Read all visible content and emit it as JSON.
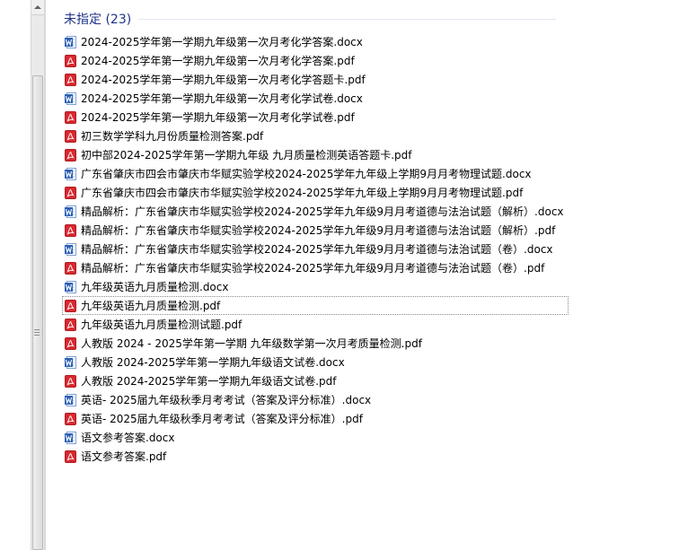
{
  "group": {
    "title": "未指定 (23)"
  },
  "files": [
    {
      "name": "2024-2025学年第一学期九年级第一次月考化学答案.docx",
      "type": "word-icon"
    },
    {
      "name": "2024-2025学年第一学期九年级第一次月考化学答案.pdf",
      "type": "pdf-icon"
    },
    {
      "name": "2024-2025学年第一学期九年级第一次月考化学答题卡.pdf",
      "type": "pdf-icon"
    },
    {
      "name": "2024-2025学年第一学期九年级第一次月考化学试卷.docx",
      "type": "word-icon"
    },
    {
      "name": "2024-2025学年第一学期九年级第一次月考化学试卷.pdf",
      "type": "pdf-icon"
    },
    {
      "name": "初三数学学科九月份质量检测答案.pdf",
      "type": "pdf-icon"
    },
    {
      "name": "初中部2024-2025学年第一学期九年级 九月质量检测英语答题卡.pdf",
      "type": "pdf-icon"
    },
    {
      "name": "广东省肇庆市四会市肇庆市华赋实验学校2024-2025学年九年级上学期9月月考物理试题.docx",
      "type": "word-icon"
    },
    {
      "name": "广东省肇庆市四会市肇庆市华赋实验学校2024-2025学年九年级上学期9月月考物理试题.pdf",
      "type": "pdf-icon"
    },
    {
      "name": "精品解析：广东省肇庆市华赋实验学校2024-2025学年九年级9月月考道德与法治试题（解析）.docx",
      "type": "word-icon"
    },
    {
      "name": "精品解析：广东省肇庆市华赋实验学校2024-2025学年九年级9月月考道德与法治试题（解析）.pdf",
      "type": "pdf-icon"
    },
    {
      "name": "精品解析：广东省肇庆市华赋实验学校2024-2025学年九年级9月月考道德与法治试题（卷）.docx",
      "type": "word-icon"
    },
    {
      "name": "精品解析：广东省肇庆市华赋实验学校2024-2025学年九年级9月月考道德与法治试题（卷）.pdf",
      "type": "pdf-icon"
    },
    {
      "name": "九年级英语九月质量检测.docx",
      "type": "word-icon"
    },
    {
      "name": "九年级英语九月质量检测.pdf",
      "type": "pdf-icon",
      "focused": true
    },
    {
      "name": "九年级英语九月质量检测试题.pdf",
      "type": "pdf-icon"
    },
    {
      "name": "人教版 2024 - 2025学年第一学期 九年级数学第一次月考质量检测.pdf",
      "type": "pdf-icon"
    },
    {
      "name": "人教版 2024-2025学年第一学期九年级语文试卷.docx",
      "type": "word-icon"
    },
    {
      "name": "人教版 2024-2025学年第一学期九年级语文试卷.pdf",
      "type": "pdf-icon"
    },
    {
      "name": "英语- 2025届九年级秋季月考考试（答案及评分标准）.docx",
      "type": "word-icon"
    },
    {
      "name": "英语- 2025届九年级秋季月考考试（答案及评分标准）.pdf",
      "type": "pdf-icon"
    },
    {
      "name": "语文参考答案.docx",
      "type": "word-icon"
    },
    {
      "name": "语文参考答案.pdf",
      "type": "pdf-icon"
    }
  ],
  "colors": {
    "header_text": "#1e3287",
    "word_icon": "#2b5fb4",
    "pdf_icon": "#d9282f"
  }
}
